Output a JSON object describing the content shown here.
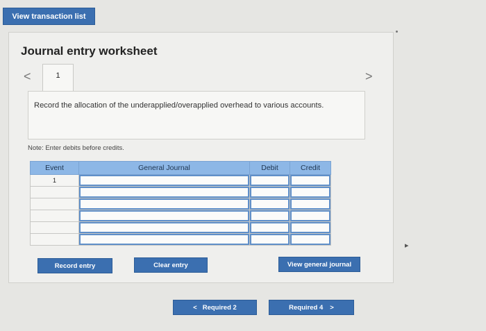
{
  "top_bar": {
    "view_transaction_list": "View transaction list"
  },
  "worksheet": {
    "title": "Journal entry worksheet",
    "nav_prev": "<",
    "nav_next": ">",
    "page_tab": "1",
    "instruction": "Record the allocation of the underapplied/overapplied overhead to various accounts.",
    "note": "Note: Enter debits before credits."
  },
  "table": {
    "headers": [
      "Event",
      "General Journal",
      "Debit",
      "Credit"
    ],
    "event_first_row": "1"
  },
  "buttons": {
    "record_entry": "Record entry",
    "clear_entry": "Clear entry",
    "view_general_journal": "View general journal"
  },
  "pager": {
    "prev_label": "Required 2",
    "prev_icon": "<",
    "next_label": "Required 4",
    "next_icon": ">"
  }
}
